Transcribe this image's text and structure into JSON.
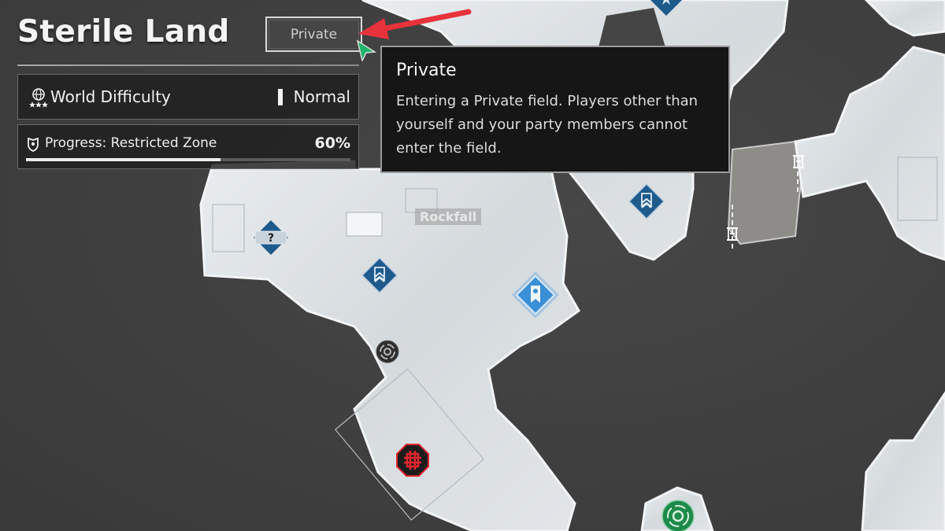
{
  "header": {
    "region_title": "Sterile Land",
    "field_mode_button": "Private"
  },
  "difficulty": {
    "label": "World Difficulty",
    "value": "Normal",
    "icon": "globe-stars-icon"
  },
  "progress": {
    "label": "Progress: Restricted Zone",
    "value_text": "60%",
    "fraction": 0.6,
    "icon": "shield-badge-icon"
  },
  "tooltip": {
    "title": "Private",
    "body": "Entering a Private field. Players other than yourself and your party members cannot enter the field."
  },
  "map": {
    "location_labels": [
      "Rockfall"
    ],
    "markers": [
      {
        "type": "mystery-question-icon"
      },
      {
        "type": "waypoint-chevron-icon"
      },
      {
        "type": "waypoint-chevron-icon"
      },
      {
        "type": "waypoint-chevron-icon"
      },
      {
        "type": "active-quest-banner-icon"
      },
      {
        "type": "dungeon-ring-icon"
      },
      {
        "type": "boss-red-icon"
      },
      {
        "type": "teleport-green-icon"
      },
      {
        "type": "gate-icon"
      },
      {
        "type": "gate-icon"
      }
    ]
  },
  "annotation": {
    "arrow_color": "#e8323c",
    "cursor_color": "#1fb36b"
  },
  "colors": {
    "marker_blue": "#1f5a8c",
    "marker_blue_active": "#3a8fd6",
    "boss_red": "#e0262e",
    "teleport_green": "#1e8a4a"
  }
}
